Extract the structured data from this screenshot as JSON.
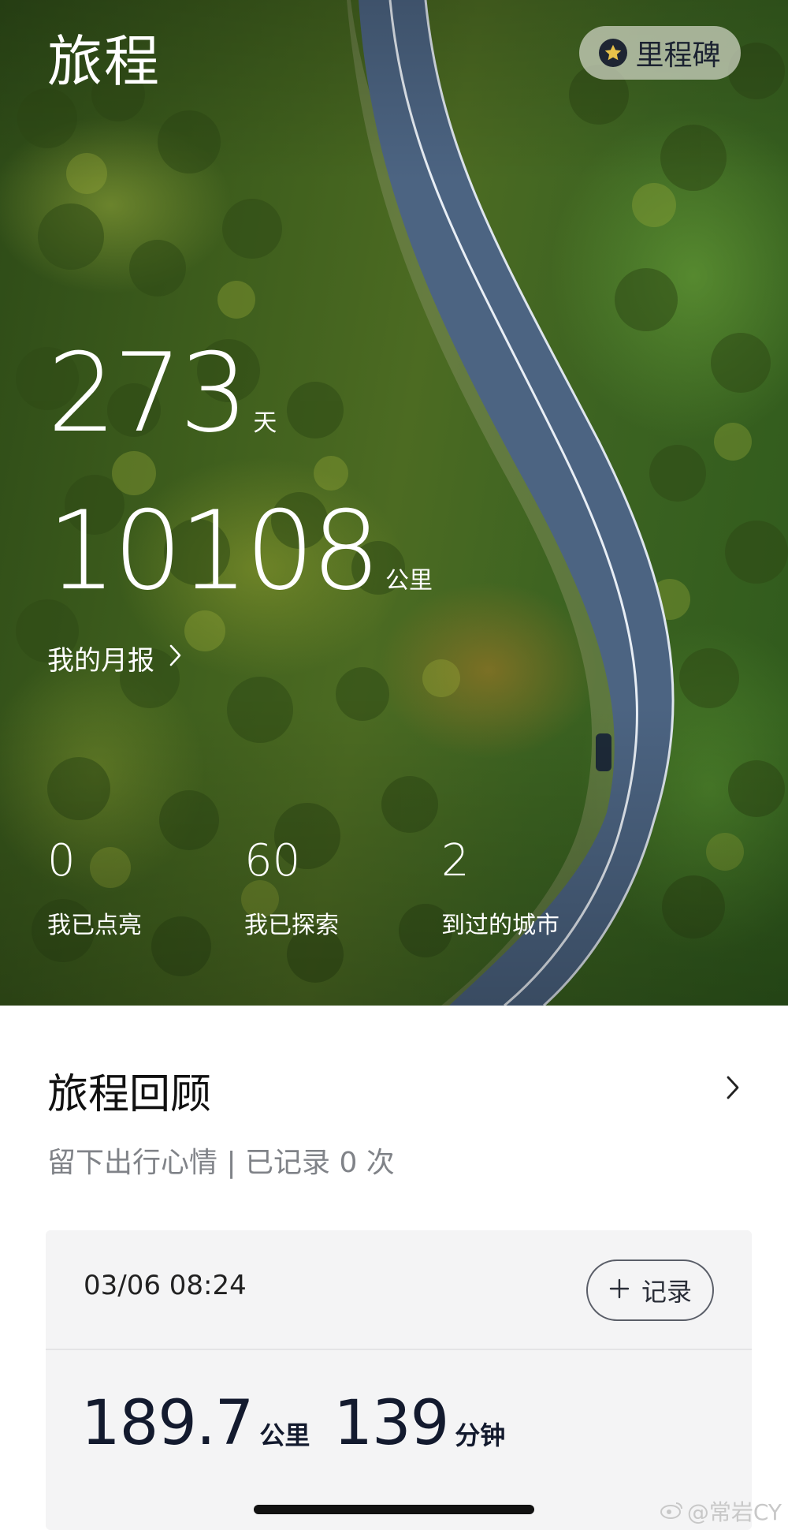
{
  "hero": {
    "title": "旅程",
    "milestone_label": "里程碑",
    "days_value": "273",
    "days_unit": "天",
    "distance_value": "10108",
    "distance_unit": "公里",
    "monthly_report_label": "我的月报",
    "stats": [
      {
        "value": "0",
        "label": "我已点亮"
      },
      {
        "value": "60",
        "label": "我已探索"
      },
      {
        "value": "2",
        "label": "到过的城市"
      }
    ]
  },
  "review": {
    "title": "旅程回顾",
    "subtitle": "留下出行心情 | 已记录 0 次",
    "card": {
      "datetime": "03/06 08:24",
      "record_label": "记录",
      "distance_value": "189.7",
      "distance_unit": "公里",
      "duration_value": "139",
      "duration_unit": "分钟"
    }
  },
  "watermark": "@常岩CY",
  "colors": {
    "text_dark": "#131a2e",
    "subtitle_gray": "#808388",
    "card_bg": "#f4f4f5"
  },
  "icons": [
    "star-icon",
    "chevron-right-icon",
    "plus-icon",
    "weibo-icon"
  ]
}
